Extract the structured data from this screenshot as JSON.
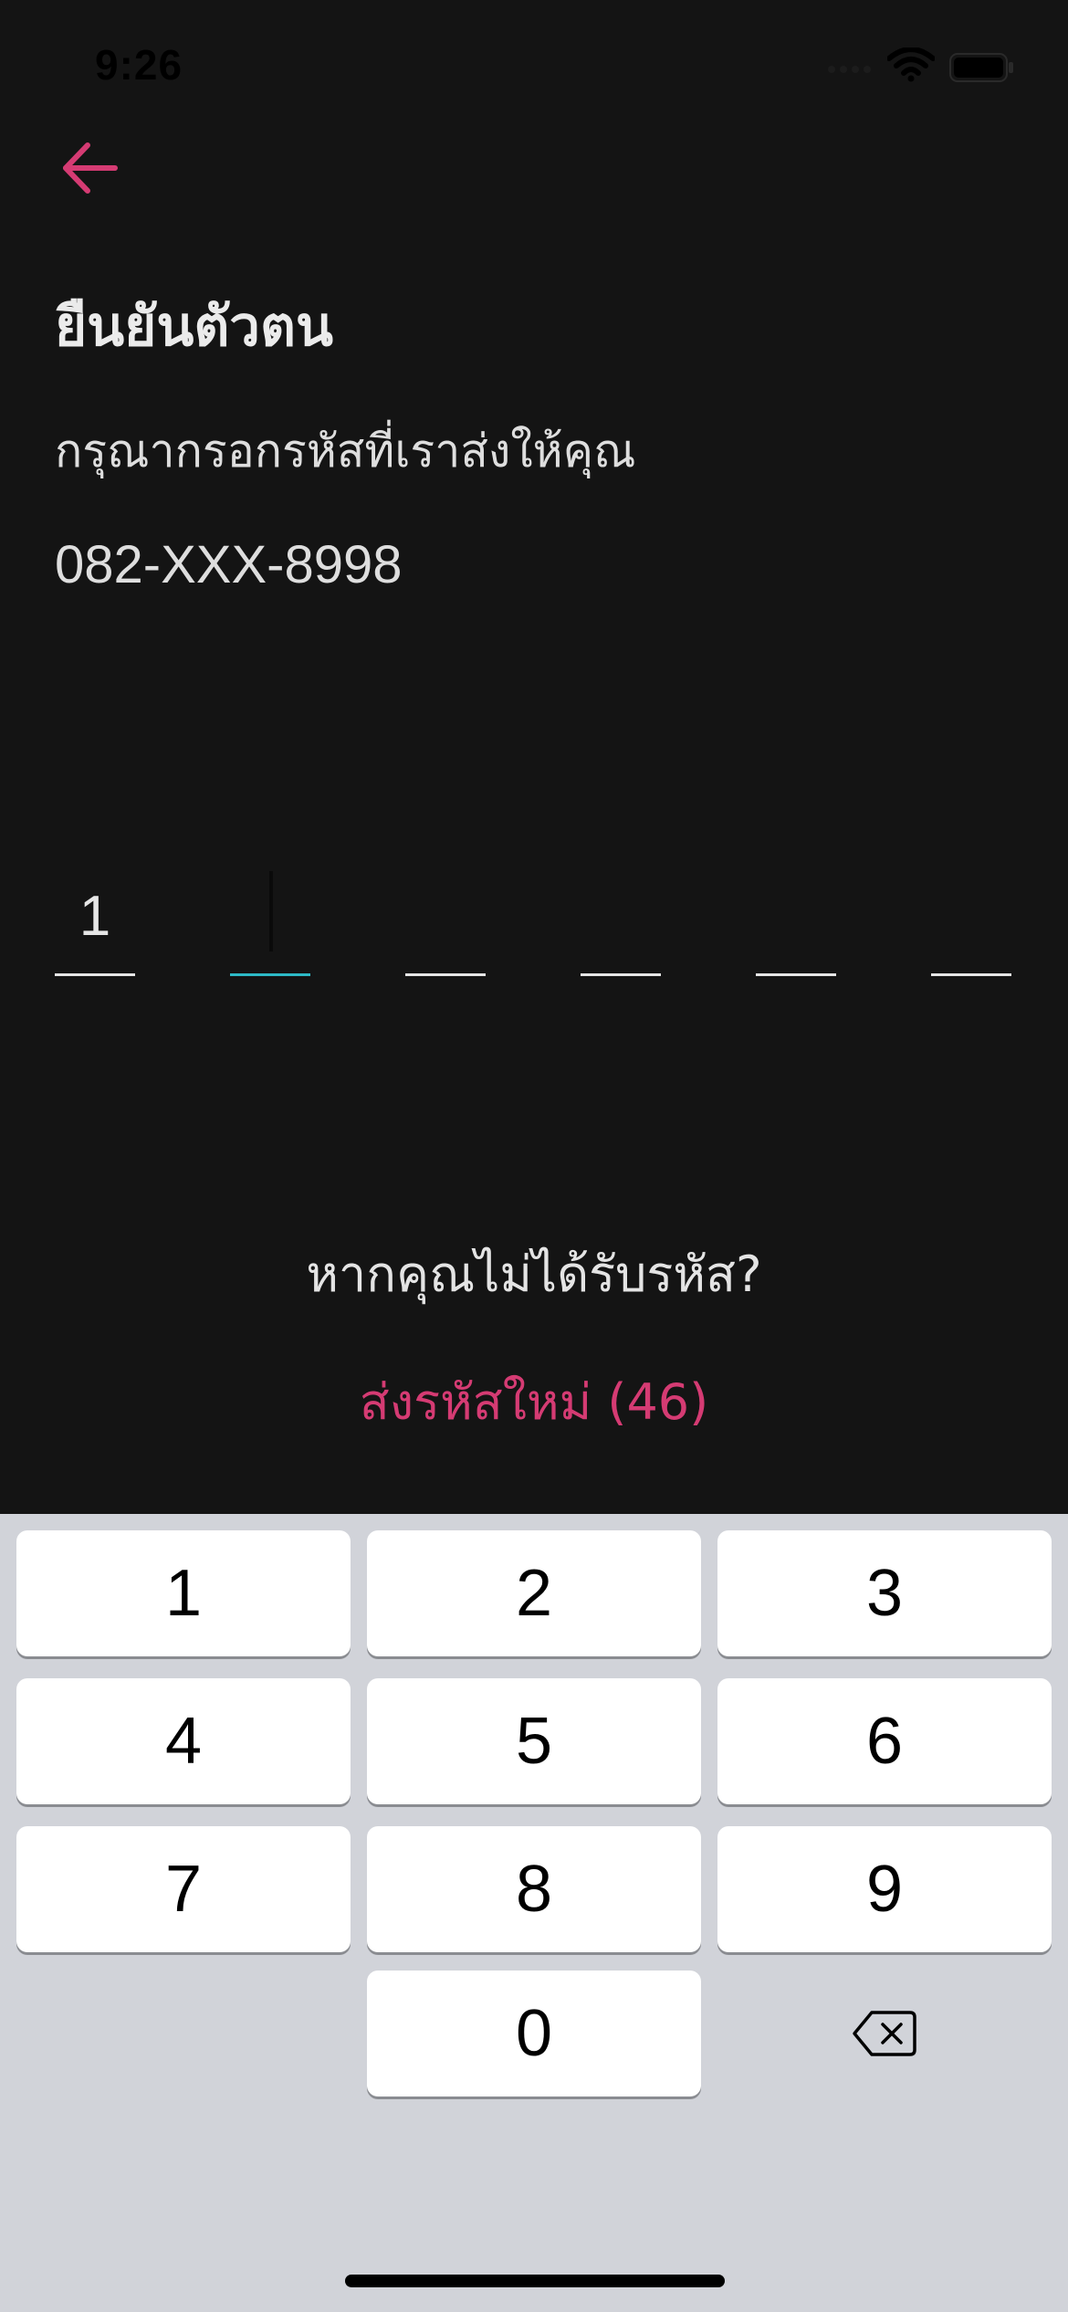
{
  "status_bar": {
    "time": "9:26"
  },
  "header": {
    "back_icon": "arrow-left-icon",
    "accent_color": "#d53b73"
  },
  "content": {
    "title": "ยืนยันตัวตน",
    "subtitle": "กรุณากรอกรหัสที่เราส่งให้คุณ",
    "phone": "082-XXX-8998"
  },
  "otp": {
    "digits": [
      "1",
      "",
      "",
      "",
      "",
      ""
    ],
    "active_index": 1,
    "active_color": "#2db9c6"
  },
  "resend": {
    "question": "หากคุณไม่ได้รับรหัส?",
    "link": "ส่งรหัสใหม่ (46)"
  },
  "keypad": {
    "keys": [
      "1",
      "2",
      "3",
      "4",
      "5",
      "6",
      "7",
      "8",
      "9",
      "0"
    ],
    "backspace_icon": "backspace-icon"
  }
}
